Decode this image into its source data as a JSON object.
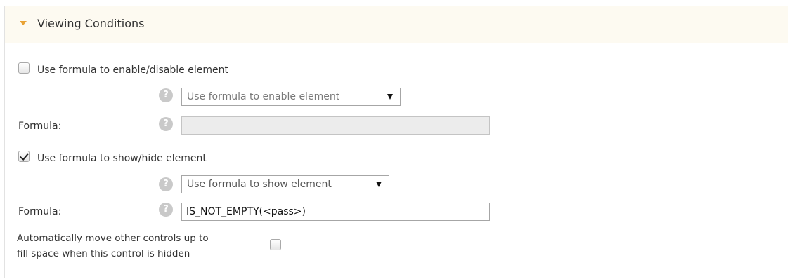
{
  "section": {
    "title": "Viewing Conditions",
    "expanded_icon": "triangle-down-icon"
  },
  "enable_rule": {
    "checkbox_label": "Use formula to enable/disable element",
    "checked": false,
    "mode_selected": "Use formula to enable element",
    "formula_label": "Formula:",
    "formula_value": "",
    "formula_disabled": true
  },
  "show_rule": {
    "checkbox_label": "Use formula to show/hide element",
    "checked": true,
    "mode_selected": "Use formula to show element",
    "formula_label": "Formula:",
    "formula_value": "IS_NOT_EMPTY(<pass>)"
  },
  "auto_move": {
    "label_line1": "Automatically move other controls up to",
    "label_line2": "fill space when this control is hidden",
    "checked": false
  },
  "help_glyph": "?"
}
